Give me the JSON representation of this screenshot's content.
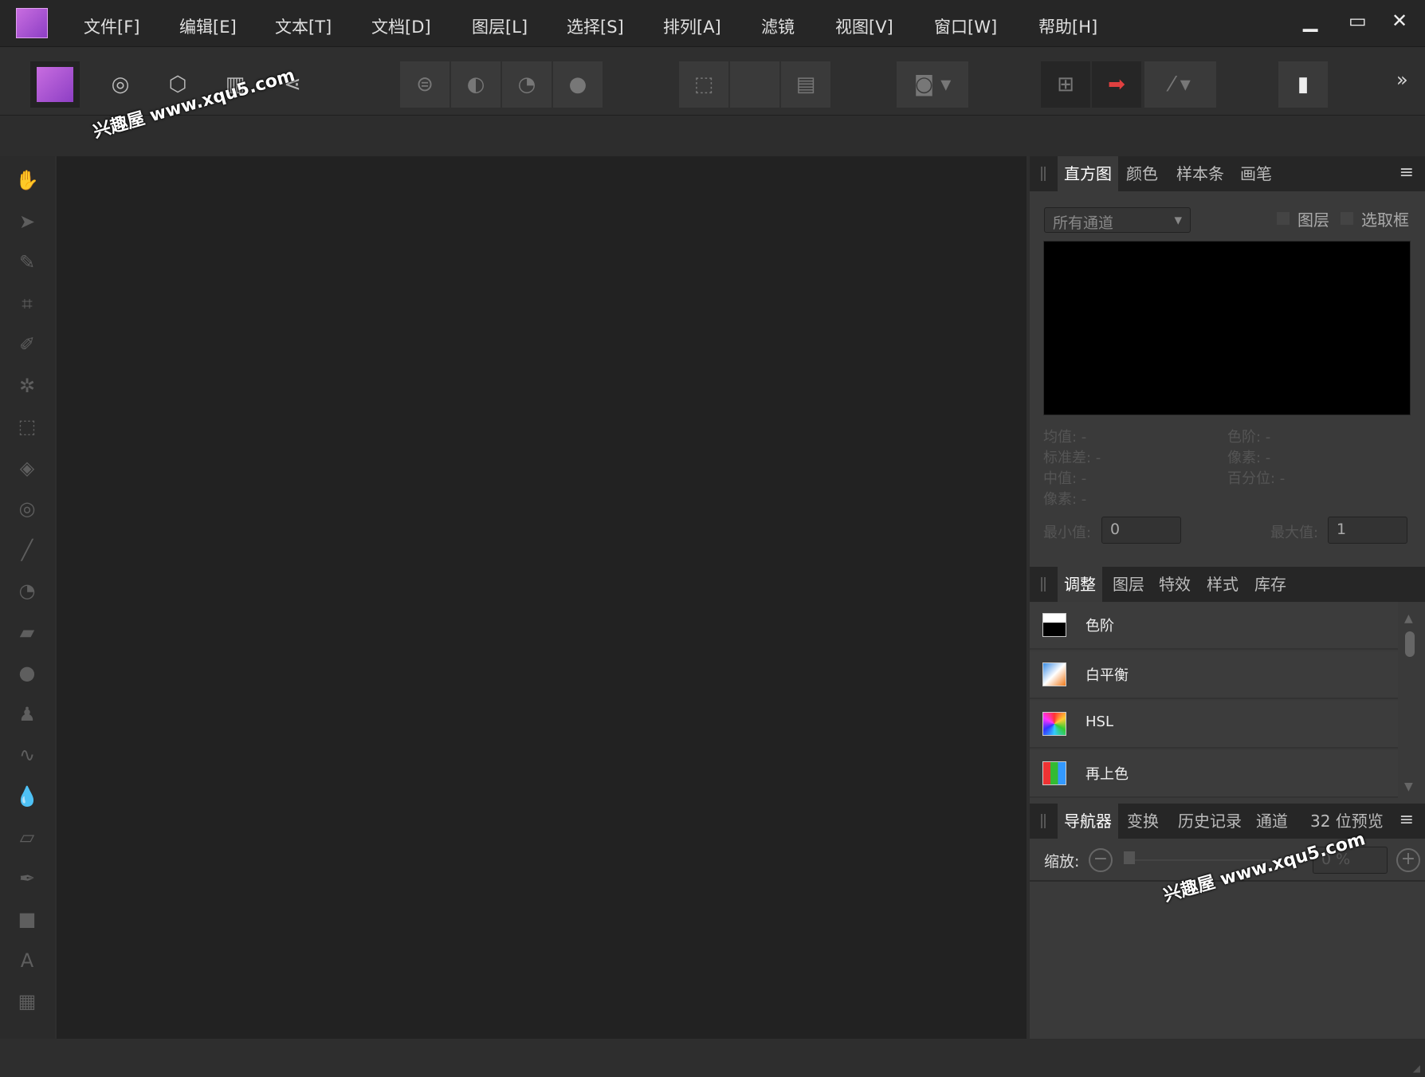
{
  "menu": [
    "文件[F]",
    "编辑[E]",
    "文本[T]",
    "文档[D]",
    "图层[L]",
    "选择[S]",
    "排列[A]",
    "滤镜",
    "视图[V]",
    "窗口[W]",
    "帮助[H]"
  ],
  "window": {
    "minimize": "▁",
    "maximize": "▭",
    "close": "✕"
  },
  "toolbar": {
    "more": "»"
  },
  "tools": [
    {
      "name": "hand-tool",
      "icon": "✋"
    },
    {
      "name": "move-tool",
      "icon": "➤"
    },
    {
      "name": "color-picker-tool",
      "icon": "✎"
    },
    {
      "name": "crop-tool",
      "icon": "⌗"
    },
    {
      "name": "selection-brush-tool",
      "icon": "✐"
    },
    {
      "name": "magic-wand-tool",
      "icon": "✲"
    },
    {
      "name": "marquee-tool",
      "icon": "⬚"
    },
    {
      "name": "flood-fill-tool",
      "icon": "◈"
    },
    {
      "name": "gradient-tool",
      "icon": "◎"
    },
    {
      "name": "paint-brush-tool",
      "icon": "╱"
    },
    {
      "name": "dodge-tool",
      "icon": "◔"
    },
    {
      "name": "healing-tool",
      "icon": "▰"
    },
    {
      "name": "burn-tool",
      "icon": "●"
    },
    {
      "name": "clone-tool",
      "icon": "♟"
    },
    {
      "name": "smudge-tool",
      "icon": "∿"
    },
    {
      "name": "blur-tool",
      "icon": "💧"
    },
    {
      "name": "erase-tool",
      "icon": "▱"
    },
    {
      "name": "pen-tool",
      "icon": "✒"
    },
    {
      "name": "rectangle-tool",
      "icon": "■"
    },
    {
      "name": "text-tool",
      "icon": "A"
    },
    {
      "name": "mesh-warp-tool",
      "icon": "▦"
    }
  ],
  "histogram_panel": {
    "tabs": [
      "直方图",
      "颜色",
      "样本条",
      "画笔"
    ],
    "channel": "所有通道",
    "layer_checkbox": "图层",
    "marquee_checkbox": "选取框",
    "stats_left": [
      "均值: -",
      "标准差: -",
      "中值: -",
      "像素: -"
    ],
    "stats_right": [
      "色阶: -",
      "像素: -",
      "百分位: -"
    ],
    "min_label": "最小值:",
    "min_value": "0",
    "max_label": "最大值:",
    "max_value": "1"
  },
  "adjust_panel": {
    "tabs": [
      "调整",
      "图层",
      "特效",
      "样式",
      "库存"
    ],
    "items": [
      "色阶",
      "白平衡",
      "HSL",
      "再上色"
    ]
  },
  "navigator_panel": {
    "tabs": [
      "导航器",
      "变换",
      "历史记录",
      "通道",
      "32 位预览"
    ],
    "zoom_label": "缩放:",
    "zoom_value": "0 %",
    "zoom_fraction": 0
  },
  "watermark": "兴趣屋 www.xqu5.com"
}
